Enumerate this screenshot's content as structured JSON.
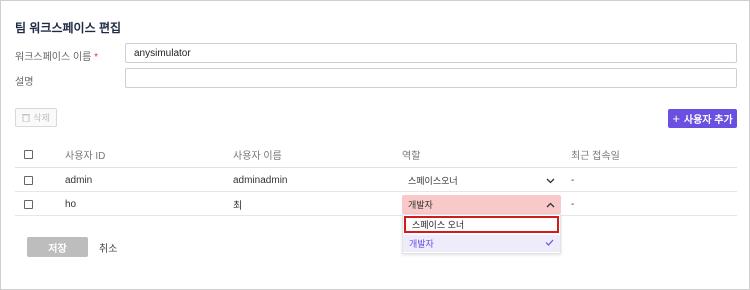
{
  "page": {
    "title": "팀 워크스페이스 편집"
  },
  "form": {
    "name_label": "워크스페이스 이름",
    "name_required": "*",
    "name_value": "anysimulator",
    "desc_label": "설명",
    "desc_value": ""
  },
  "toolbar": {
    "delete_label": "삭제",
    "add_user_label": "사용자 추가",
    "add_icon": "plus-icon"
  },
  "table": {
    "headers": [
      "사용자 ID",
      "사용자 이름",
      "역할",
      "최근 접속일"
    ],
    "rows": [
      {
        "id": "admin",
        "name": "adminadmin",
        "role": "스페이스오너",
        "last_login": "-"
      },
      {
        "id": "ho",
        "name": "최",
        "role": "개발자",
        "last_login": "-"
      }
    ]
  },
  "dropdown": {
    "options": [
      "스페이스 오너",
      "개발자"
    ],
    "selected_index": 1
  },
  "actions": {
    "save_label": "저장",
    "cancel_label": "취소"
  },
  "colors": {
    "accent": "#6a4fe0",
    "select_active_bg": "#f9c9c9",
    "highlight_border": "#d11c1c"
  }
}
